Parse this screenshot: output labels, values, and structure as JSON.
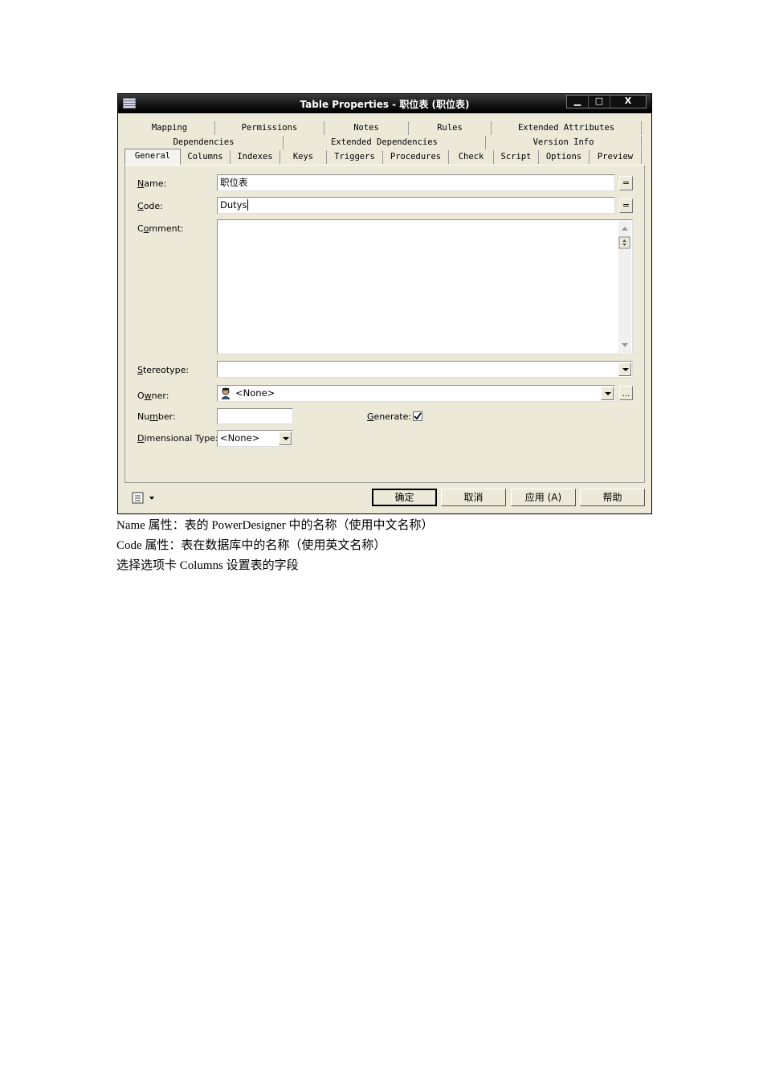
{
  "window": {
    "title": "Table Properties - 职位表 (职位表)",
    "min_label": "▁",
    "max_label": "□",
    "close_label": "X"
  },
  "tabs": {
    "row1": [
      "Mapping",
      "Permissions",
      "Notes",
      "Rules",
      "Extended Attributes"
    ],
    "row2": [
      "Dependencies",
      "Extended Dependencies",
      "Version Info"
    ],
    "row3": [
      "General",
      "Columns",
      "Indexes",
      "Keys",
      "Triggers",
      "Procedures",
      "Check",
      "Script",
      "Options",
      "Preview"
    ],
    "active": "General"
  },
  "form": {
    "name_label_u": "N",
    "name_label_rest": "ame:",
    "name_value": "职位表",
    "code_label_u": "C",
    "code_label_rest": "ode:",
    "code_value": "Dutys",
    "comment_label_pre": "C",
    "comment_label_u": "o",
    "comment_label_rest": "mment:",
    "comment_value": "",
    "stereotype_label_u": "S",
    "stereotype_label_rest": "tereotype:",
    "stereotype_value": "",
    "owner_label_pre": "O",
    "owner_label_u": "w",
    "owner_label_rest": "ner:",
    "owner_value": "<None>",
    "number_label_pre": "Nu",
    "number_label_u": "m",
    "number_label_rest": "ber:",
    "number_value": "",
    "generate_label_u": "G",
    "generate_label_rest": "enerate:",
    "generate_checked": true,
    "dimensional_label_u": "D",
    "dimensional_label_rest": "imensional Type:",
    "dimensional_value": "<None>",
    "eq_label": "=",
    "browse_label": "..."
  },
  "buttons": {
    "ok": "确定",
    "cancel": "取消",
    "apply": "应用 (A)",
    "help": "帮助"
  },
  "text": {
    "line1": "Name 属性：表的 PowerDesigner 中的名称（使用中文名称）",
    "line2": "Code 属性：表在数据库中的名称（使用英文名称）",
    "line3": "选择选项卡 Columns 设置表的字段"
  }
}
